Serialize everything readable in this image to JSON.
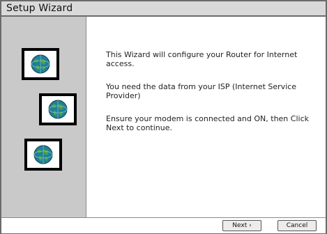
{
  "window": {
    "title": "Setup Wizard"
  },
  "content": {
    "paragraphs": [
      "This Wizard will configure your Router for Internet access.",
      "You need the data from your ISP (Internet Service Provider)",
      "Ensure your modem is connected and ON, then Click Next to continue."
    ]
  },
  "buttons": {
    "next": "Next ›",
    "cancel": "Cancel"
  },
  "icons": {
    "sidebar": [
      "globe-icon",
      "globe-icon",
      "globe-icon"
    ]
  },
  "colors": {
    "sidebar_bg": "#c9c9c9",
    "titlebar_bg": "#d9d9d9",
    "globe_ocean": "#1f7f9a",
    "globe_land": "#4aa34a"
  }
}
